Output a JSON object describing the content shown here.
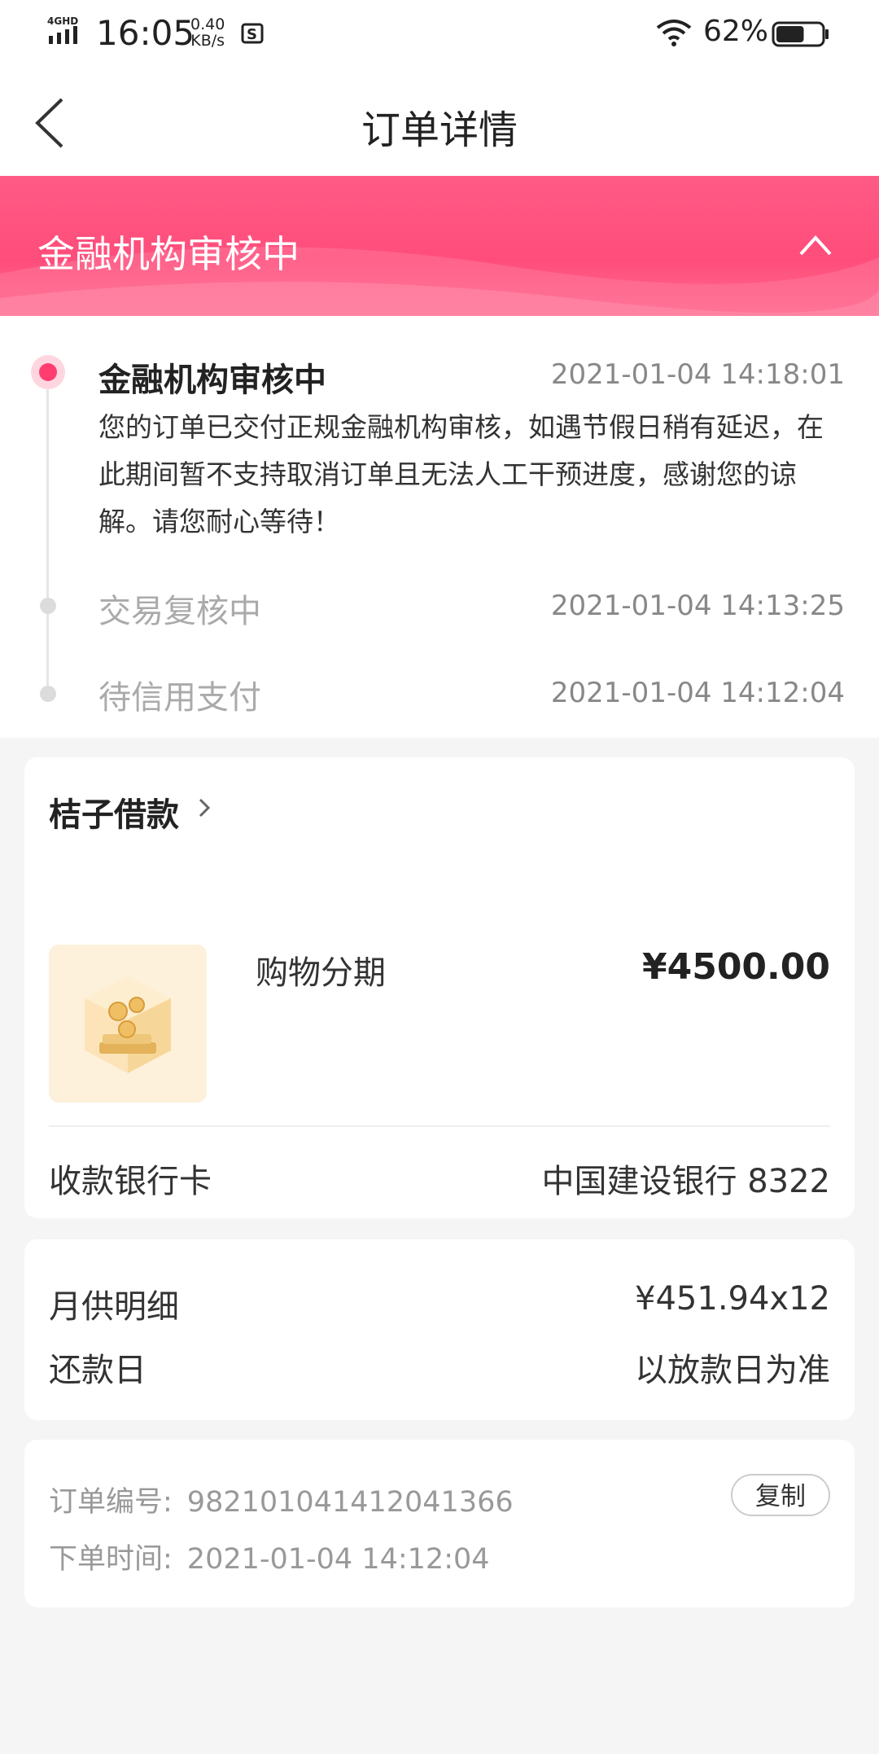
{
  "status_bar": {
    "network": "4GHD",
    "time": "16:05",
    "speed_value": "0.40",
    "speed_unit": "KB/s",
    "battery": "62%",
    "battery_level": 0.62
  },
  "nav": {
    "title": "订单详情"
  },
  "banner": {
    "status": "金融机构审核中",
    "accent": "#ff4d7b"
  },
  "timeline": [
    {
      "title": "金融机构审核中",
      "time": "2021-01-04 14:18:01",
      "desc": "您的订单已交付正规金融机构审核，如遇节假日稍有延迟，在此期间暂不支持取消订单且无法人工干预进度，感谢您的谅解。请您耐心等待！"
    },
    {
      "title": "交易复核中",
      "time": "2021-01-04 14:13:25"
    },
    {
      "title": "待信用支付",
      "time": "2021-01-04 14:12:04"
    }
  ],
  "order": {
    "lender": "桔子借款",
    "product": "购物分期",
    "price": "¥4500.00",
    "bank_label": "收款银行卡",
    "bank_value": "中国建设银行 8322"
  },
  "repayment": {
    "monthly_label": "月供明细",
    "monthly_value": "¥451.94x12",
    "date_label": "还款日",
    "date_value": "以放款日为准"
  },
  "info": {
    "order_no_label": "订单编号:",
    "order_no": "98210104141204136​6",
    "time_label": "下单时间:",
    "time_value": "2021-01-04 14:12:04",
    "copy_label": "复制"
  }
}
